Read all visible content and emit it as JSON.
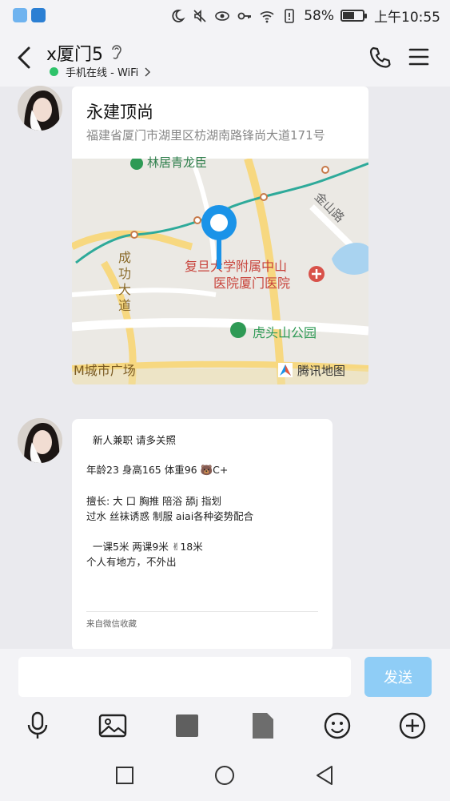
{
  "status_bar": {
    "battery": "58%",
    "time": "上午10:55",
    "battery_level": 0.58
  },
  "header": {
    "title": "x厦门5",
    "online_status": "手机在线 - WiFi"
  },
  "location_message": {
    "name": "永建顶尚",
    "address": "福建省厦门市湖里区枋湖南路锋尚大道171号",
    "map_labels": {
      "poi_top": "林居青龙臣",
      "road_left": "成功大道",
      "road_right": "金山路",
      "hospital": "复旦大学附属中山医院厦门医院",
      "hospital_line1": "复旦大学附属中山",
      "hospital_line2": "医院厦门医院",
      "park": "虎头山公园",
      "mall": "M城市广场",
      "provider": "腾讯地图"
    }
  },
  "text_message": {
    "lines": [
      "新人兼职   请多关照",
      "年龄23  身高165  体重96  🐻C+",
      "擅长: 大 口  胸推  陪浴  舔j  指划",
      "过水   丝袜诱惑  制服  aiai各种姿势配合",
      "一课5米   两课9米  ✌18米",
      "个人有地方，不外出"
    ],
    "source": "来自微信收藏"
  },
  "input": {
    "placeholder": "",
    "send_label": "发送"
  },
  "colors": {
    "send_button": "#8fcdf6",
    "online_dot": "#2ec36a",
    "map_pin": "#1a93e8",
    "hospital_red": "#c8443c",
    "park_green": "#2e9a55"
  }
}
